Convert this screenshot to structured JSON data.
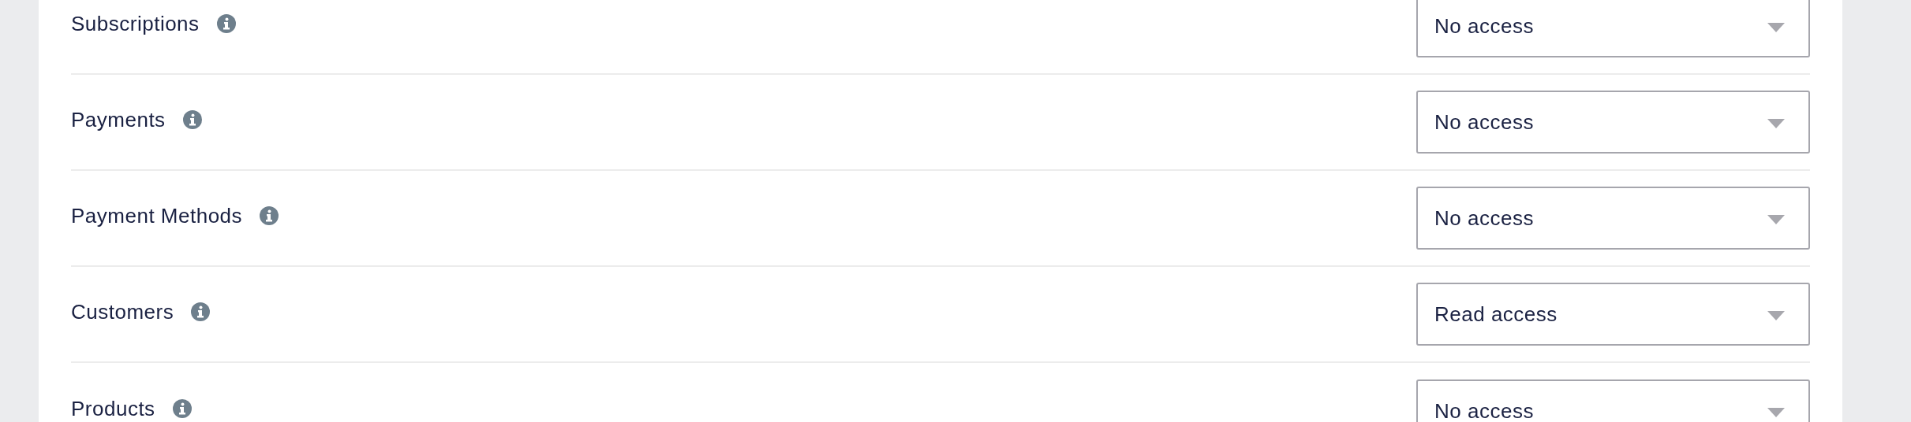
{
  "permissions": [
    {
      "label": "Subscriptions",
      "value": "No access"
    },
    {
      "label": "Payments",
      "value": "No access"
    },
    {
      "label": "Payment Methods",
      "value": "No access"
    },
    {
      "label": "Customers",
      "value": "Read access"
    },
    {
      "label": "Products",
      "value": "No access"
    }
  ]
}
